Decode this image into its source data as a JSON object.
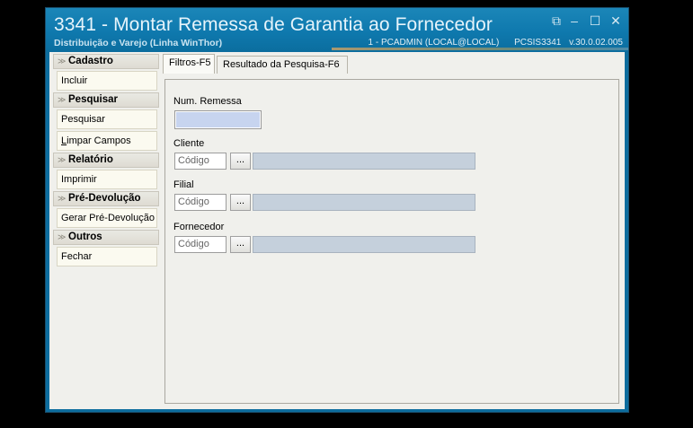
{
  "window": {
    "title": "3341 - Montar Remessa de Garantia ao Fornecedor",
    "subtitle": "Distribuição e Varejo (Linha WinThor)",
    "user": "1 - PCADMIN (LOCAL@LOCAL)",
    "program": "PCSIS3341",
    "version": "v.30.0.02.005",
    "controls": {
      "restore": "⧉",
      "minimize": "–",
      "maximize": "☐",
      "close": "✕"
    }
  },
  "sidebar": {
    "chevron": "≫",
    "groups": [
      {
        "title": "Cadastro",
        "items": [
          "Incluir"
        ]
      },
      {
        "title": "Pesquisar",
        "items": [
          "Pesquisar",
          "Limpar Campos"
        ]
      },
      {
        "title": "Relatório",
        "items": [
          "Imprimir"
        ]
      },
      {
        "title": "Pré-Devolução",
        "items": [
          "Gerar Pré-Devolução"
        ]
      },
      {
        "title": "Outros",
        "items": [
          "Fechar"
        ]
      }
    ],
    "limpar_first": "L",
    "limpar_rest": "impar Campos"
  },
  "tabs": [
    {
      "label": "Filtros-F5",
      "active": true
    },
    {
      "label": "Resultado da Pesquisa-F6",
      "active": false
    }
  ],
  "filters": {
    "num_remessa_label": "Num. Remessa",
    "num_remessa_value": "",
    "cliente_label": "Cliente",
    "filial_label": "Filial",
    "fornecedor_label": "Fornecedor",
    "codigo_placeholder": "Código",
    "lookup_button": "...",
    "cliente_desc": "",
    "filial_desc": "",
    "fornecedor_desc": ""
  }
}
